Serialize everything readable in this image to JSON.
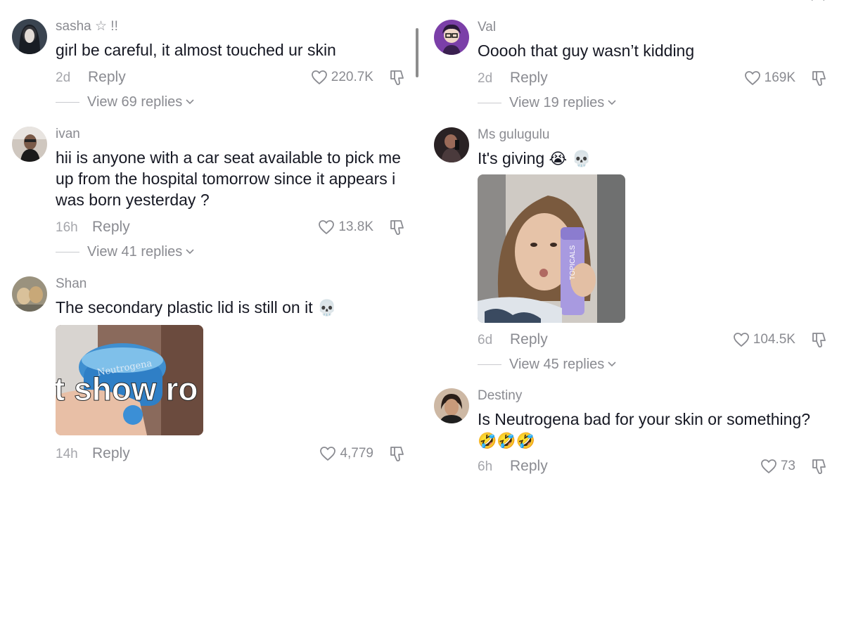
{
  "icons": {
    "heart": "heart-outline-icon",
    "dislike": "thumbs-down-icon",
    "chevron": "chevron-down-icon",
    "close": "close-icon"
  },
  "colors": {
    "username": "#8a8b91",
    "text": "#161823",
    "muted": "#a5a6ab"
  },
  "left_column": {
    "comments": [
      {
        "username": "sasha ☆ !!",
        "text": "girl be careful, it almost touched ur skin",
        "time": "2d",
        "reply_label": "Reply",
        "likes": "220.7K",
        "view_replies": "View 69 replies"
      },
      {
        "username": "ivan",
        "text": "hii is anyone with a car seat available to pick me up from the hospital tomorrow since it appears i was born yesterday ?",
        "time": "16h",
        "reply_label": "Reply",
        "likes": "13.8K",
        "view_replies": "View 41 replies"
      },
      {
        "username": "Shan",
        "text": "The secondary plastic lid is still on it",
        "emoji": "💀",
        "media_caption": "t show ro",
        "media_brand": "Neutrogena",
        "time": "14h",
        "reply_label": "Reply",
        "likes": "4,779"
      }
    ]
  },
  "right_column": {
    "comments": [
      {
        "username": "Val",
        "text": "Ooooh that guy wasn’t kidding",
        "time": "2d",
        "reply_label": "Reply",
        "likes": "169K",
        "view_replies": "View 19 replies"
      },
      {
        "username": "Ms gulugulu",
        "text": "It's giving",
        "emoji": "😭 💀",
        "media_product_label": "TOPICALS",
        "time": "6d",
        "reply_label": "Reply",
        "likes": "104.5K",
        "view_replies": "View 45 replies"
      },
      {
        "username": "Destiny",
        "text": "Is Neutrogena bad for your skin or something?",
        "emoji": "🤣🤣🤣",
        "time": "6h",
        "reply_label": "Reply",
        "likes": "73"
      }
    ]
  }
}
